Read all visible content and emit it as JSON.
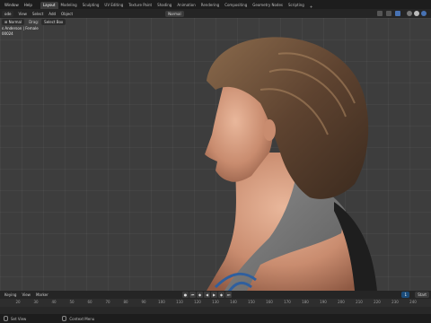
{
  "top_menu": [
    "Window",
    "Help"
  ],
  "workspace_tabs": [
    "Layout",
    "Modeling",
    "Sculpting",
    "UV Editing",
    "Texture Paint",
    "Shading",
    "Animation",
    "Rendering",
    "Compositing",
    "Geometry Nodes",
    "Scripting"
  ],
  "workspace_add": "+",
  "viewport_header": {
    "mode": "ode",
    "menus": [
      "View",
      "Select",
      "Add",
      "Object"
    ],
    "orientation": "Normal",
    "drag": "Drag:",
    "drag_value": "Select Box"
  },
  "viewport_overlay": {
    "line1": "ective",
    "line2": "s Anderson | Female",
    "line3": "00024"
  },
  "timeline": {
    "menus": [
      "Keying",
      "View",
      "Marker"
    ],
    "current_frame": "1",
    "start_label": "Start",
    "ruler_ticks": [
      "20",
      "30",
      "40",
      "50",
      "60",
      "70",
      "80",
      "90",
      "100",
      "110",
      "120",
      "130",
      "140",
      "150",
      "160",
      "170",
      "180",
      "190",
      "200",
      "210",
      "220",
      "230",
      "240"
    ]
  },
  "statusbar": {
    "select_label": "Set View",
    "context_label": "Context Menu"
  },
  "colors": {
    "accent_tab": "#3d3d3d",
    "frame_highlight": "#1b4c7a",
    "viewport_bg": "#3d3d3d"
  }
}
